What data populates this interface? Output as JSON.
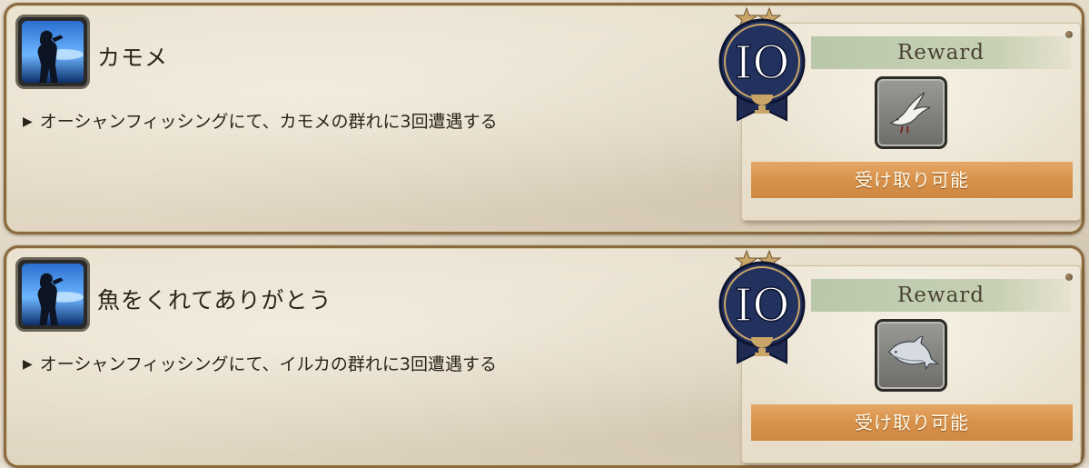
{
  "achievements": [
    {
      "title": "カモメ",
      "description": "オーシャンフィッシングにて、カモメの群れに3回遭遇する",
      "points": "IO",
      "reward_header": "Reward",
      "reward_item": "seagull-minion-icon",
      "claim_status": "受け取り可能"
    },
    {
      "title": "魚をくれてありがとう",
      "description": "オーシャンフィッシングにて、イルカの群れに3回遭遇する",
      "points": "IO",
      "reward_header": "Reward",
      "reward_item": "dolphin-minion-icon",
      "claim_status": "受け取り可能"
    }
  ],
  "bullet": "▶",
  "colors": {
    "claim_bar": "#d8914a",
    "reward_header": "#a3b88f",
    "medal_navy": "#1e2a52",
    "frame_border": "#8a6a3e"
  }
}
